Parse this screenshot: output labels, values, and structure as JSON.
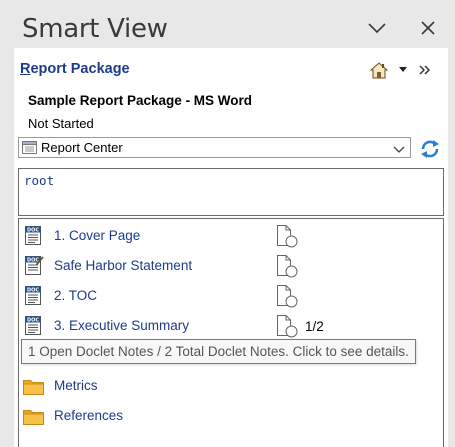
{
  "panel": {
    "title": "Smart View"
  },
  "report_package": {
    "header_first_letter": "R",
    "header_rest": "eport Package",
    "name": "Sample Report Package - MS Word",
    "status": "Not Started"
  },
  "selector": {
    "value": "Report Center"
  },
  "root": {
    "text": "root"
  },
  "tree": {
    "items": [
      {
        "label": "1. Cover Page",
        "icon": "doclet-icon",
        "notes": ""
      },
      {
        "label": "Safe Harbor Statement",
        "icon": "doclet-edit-icon",
        "notes": ""
      },
      {
        "label": "2. TOC",
        "icon": "doclet-icon",
        "notes": ""
      },
      {
        "label": "3. Executive Summary",
        "icon": "doclet-icon",
        "notes": "1/2"
      },
      {
        "label": "Metrics",
        "icon": "folder-icon",
        "notes": ""
      },
      {
        "label": "References",
        "icon": "folder-icon",
        "notes": ""
      }
    ]
  },
  "tooltip": {
    "text": "1 Open Doclet Notes / 2 Total Doclet Notes. Click to see details."
  },
  "colors": {
    "link_blue": "#1f3a8a",
    "folder_yellow": "#f2b632",
    "refresh_blue": "#2a7fd4"
  }
}
